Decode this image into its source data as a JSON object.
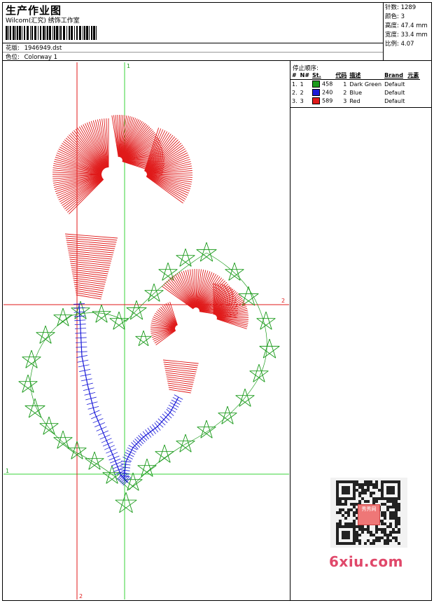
{
  "header": {
    "title": "生产作业图",
    "subtitle": "Wilcom(汇究) 绣饰工作室",
    "design_label": "花版:",
    "design_value": "1946949.dst",
    "colorway_label": "色位:",
    "colorway_value": "Colorway 1"
  },
  "stats": {
    "stitches_label": "针数:",
    "stitches_value": "1289",
    "colors_label": "颜色:",
    "colors_value": "3",
    "height_label": "高度:",
    "height_value": "47.4 mm",
    "width_label": "宽度:",
    "width_value": "33.4 mm",
    "ratio_label": "比例:",
    "ratio_value": "4.07"
  },
  "stop_sequence": {
    "title": "停止顺序:",
    "columns": [
      "#",
      "N#",
      "St.",
      "代码",
      "描述",
      "Brand",
      "元素"
    ],
    "rows": [
      {
        "idx": "1.",
        "n": "1",
        "color": "#1a9a1a",
        "st": "458",
        "code": "1",
        "desc": "Dark Green",
        "brand": "Default"
      },
      {
        "idx": "2.",
        "n": "2",
        "color": "#1a1ad8",
        "st": "240",
        "code": "2",
        "desc": "Blue",
        "brand": "Default"
      },
      {
        "idx": "3.",
        "n": "3",
        "color": "#e01a1a",
        "st": "589",
        "code": "3",
        "desc": "Red",
        "brand": "Default"
      }
    ]
  },
  "canvas": {
    "guide_label_top": "1",
    "guide_label_right": "2",
    "guide_label_left": "1",
    "guide_label_bottom": "2",
    "colors": {
      "green": "#1a9a1a",
      "blue": "#1a1ad8",
      "red": "#e01a1a",
      "guide_green": "#3ad33a",
      "guide_red": "#e01a1a"
    }
  },
  "watermark": {
    "qr_center_text": "秀秀网",
    "site": "6xiu.com"
  }
}
